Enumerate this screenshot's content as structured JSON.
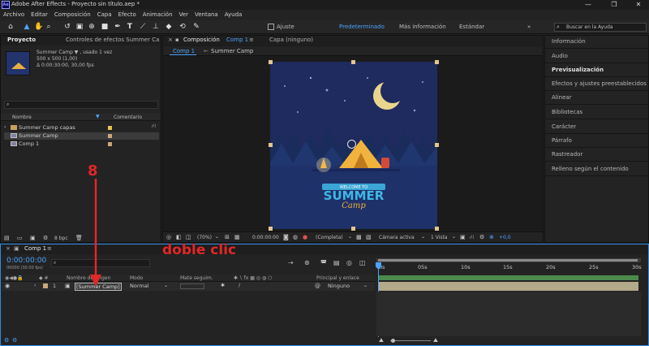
{
  "window": {
    "title": "Adobe After Effects - Proyecto sin título.aep *",
    "app_badge": "Ae"
  },
  "menu": [
    "Archivo",
    "Editar",
    "Composición",
    "Capa",
    "Efecto",
    "Animación",
    "Ver",
    "Ventana",
    "Ayuda"
  ],
  "toolbar": {
    "snap_label": "Ajuste",
    "workspaces": [
      "Predeterminado",
      "Más información",
      "Estándar"
    ],
    "search_placeholder": "Buscar en la Ayuda",
    "more_icon": "»"
  },
  "project_panel": {
    "tab_project": "Proyecto",
    "tab_effects": "Controles de efectos Summer Ca",
    "preview_name": "Summer Camp ▼ , usado 1 vez",
    "preview_info1": "500 x 500 (1,00)",
    "preview_info2": "Δ 0:00:30:00, 30,00 fps",
    "col_name": "Nombre",
    "col_comment": "Comentario",
    "items": [
      {
        "name": "Summer Camp capas",
        "type": "folder",
        "color": "#e6c34a"
      },
      {
        "name": "Summer Camp",
        "type": "comp",
        "color": "#c9a87a",
        "selected": true
      },
      {
        "name": "Comp 1",
        "type": "comp",
        "color": "#c9a87a"
      }
    ],
    "bpc": "8 bpc"
  },
  "comp_panel": {
    "tab_comp": "Composición",
    "tab_comp_name": "Comp 1",
    "tab_layer": "Capa (ninguno)",
    "breadcrumbs": [
      "Comp 1",
      "Summer Camp"
    ],
    "zoom": "(70%)",
    "timecode": "0:00:00:00",
    "resolution": "(Completa)",
    "camera": "Cámara activa",
    "views": "1 Vista",
    "exposure": "+0,0"
  },
  "artwork": {
    "badge": "WELCOME TO",
    "title": "SUMMER",
    "subtitle": "Camp"
  },
  "right_panel": {
    "items": [
      {
        "label": "Información",
        "bold": false
      },
      {
        "label": "Audio",
        "bold": false
      },
      {
        "label": "Previsualización",
        "bold": true
      },
      {
        "label": "Efectos y ajustes preestablecidos",
        "bold": false
      },
      {
        "label": "Alinear",
        "bold": false
      },
      {
        "label": "Bibliotecas",
        "bold": false
      },
      {
        "label": "Carácter",
        "bold": false
      },
      {
        "label": "Párrafo",
        "bold": false
      },
      {
        "label": "Rastreador",
        "bold": false
      },
      {
        "label": "Relleno según el contenido",
        "bold": false
      }
    ]
  },
  "timeline": {
    "tab": "Comp 1",
    "timecode": "0:00:00:00",
    "timecode_sub": "00000 (30.00 fps)",
    "col_source": "Nombre de origen",
    "col_mode": "Modo",
    "col_matte": "Mate seguim.",
    "col_parent": "Principal y enlace",
    "layer": {
      "index": "1",
      "name": "[Summer Camp]",
      "mode": "Normal",
      "parent": "Ninguno"
    },
    "ticks": [
      "0s",
      "05s",
      "10s",
      "15s",
      "20s",
      "25s",
      "30s"
    ]
  },
  "annotations": {
    "step": "8",
    "instruction": "doble clic"
  },
  "colors": {
    "accent_blue": "#2d8ceb",
    "annotation_red": "#e32626",
    "layer_bar": "#b3a98b",
    "sky": "#1d2859"
  }
}
